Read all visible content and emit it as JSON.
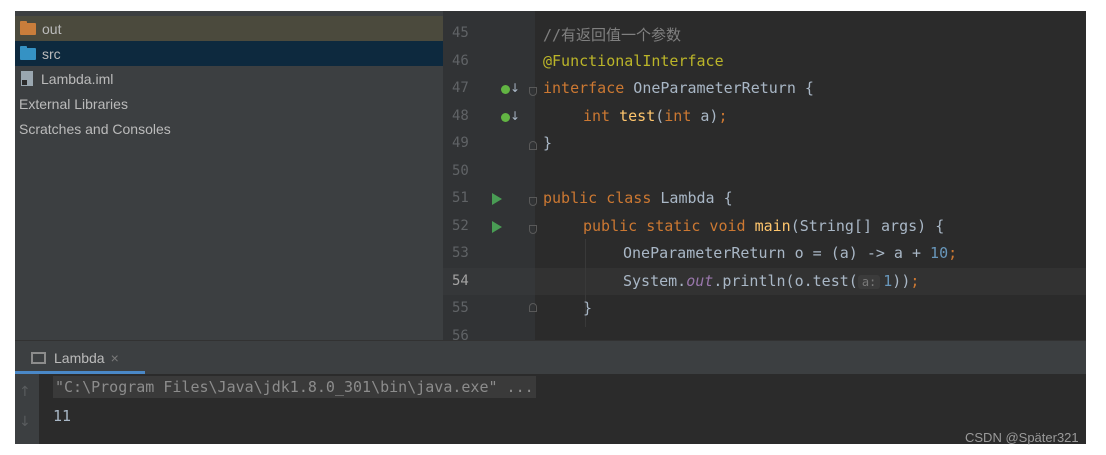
{
  "project_tree": {
    "items": [
      {
        "label": "out",
        "icon": "folder-icon",
        "color": "#c97d3b"
      },
      {
        "label": "src",
        "icon": "folder-icon",
        "color": "#3592c4"
      },
      {
        "label": "Lambda.iml",
        "icon": "module-file-icon"
      },
      {
        "label": "External Libraries",
        "icon": ""
      },
      {
        "label": "Scratches and Consoles",
        "icon": ""
      }
    ]
  },
  "editor": {
    "lines": [
      {
        "no": "45"
      },
      {
        "no": "46"
      },
      {
        "no": "47"
      },
      {
        "no": "48"
      },
      {
        "no": "49"
      },
      {
        "no": "50"
      },
      {
        "no": "51"
      },
      {
        "no": "52"
      },
      {
        "no": "53"
      },
      {
        "no": "54"
      },
      {
        "no": "55"
      },
      {
        "no": "56"
      }
    ],
    "code": {
      "l45_comment": "//有返回值一个参数",
      "l46_annotation": "@FunctionalInterface",
      "l47_kw": "interface",
      "l47_name": " OneParameterReturn {",
      "l48_kw1": "int",
      "l48_fn": "test",
      "l48_p1": "(",
      "l48_kw2": "int",
      "l48_p2": " a)",
      "l48_semi": ";",
      "l49": "}",
      "l51_kw": "public class",
      "l51_name": " Lambda {",
      "l52_kw": "public static void",
      "l52_fn": "main",
      "l52_rest": "(String[] args) {",
      "l53_text": "OneParameterReturn o = (a) -> a + ",
      "l53_num": "10",
      "l53_semi": ";",
      "l54_a": "System.",
      "l54_static": "out",
      "l54_b": ".println(o.test(",
      "l54_hint": "a:",
      "l54_num": "1",
      "l54_c": "))",
      "l54_semi": ";",
      "l55": "}"
    }
  },
  "run_panel": {
    "tab_label": "Lambda",
    "close_glyph": "×",
    "up_arrow": "↑",
    "down_arrow": "↓",
    "command": "\"C:\\Program Files\\Java\\jdk1.8.0_301\\bin\\java.exe\" ...",
    "output": "11"
  },
  "watermark": "CSDN @Später321",
  "colors": {
    "keyword": "#cc7832",
    "annotation": "#bbb529",
    "function": "#ffc66d",
    "number": "#6897bb",
    "comment": "#808080",
    "run_icon": "#499c54"
  }
}
